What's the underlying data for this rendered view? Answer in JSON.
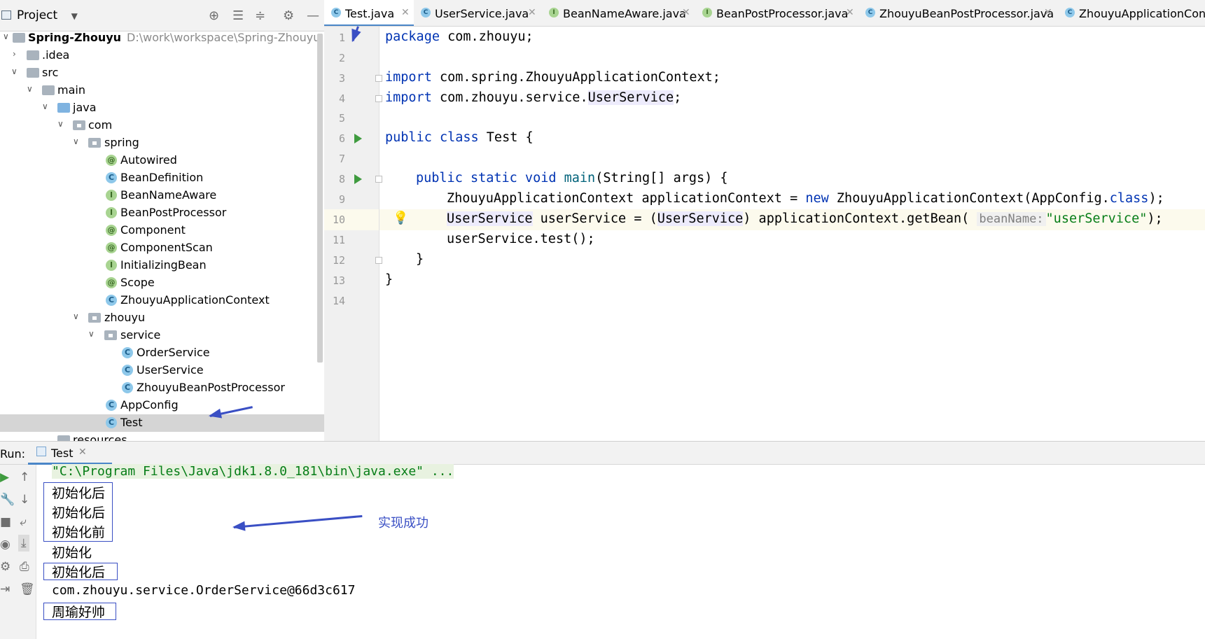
{
  "project_panel": {
    "title": "Project",
    "tree": [
      {
        "label": "Spring-Zhouyu",
        "path": "D:\\work\\workspace\\Spring-Zhouyu"
      },
      {
        "label": ".idea"
      },
      {
        "label": "src"
      },
      {
        "label": "main"
      },
      {
        "label": "java"
      },
      {
        "label": "com"
      },
      {
        "label": "spring"
      },
      {
        "label": "Autowired",
        "kind": "annotation"
      },
      {
        "label": "BeanDefinition",
        "kind": "class"
      },
      {
        "label": "BeanNameAware",
        "kind": "interface"
      },
      {
        "label": "BeanPostProcessor",
        "kind": "interface"
      },
      {
        "label": "Component",
        "kind": "annotation"
      },
      {
        "label": "ComponentScan",
        "kind": "annotation"
      },
      {
        "label": "InitializingBean",
        "kind": "interface"
      },
      {
        "label": "Scope",
        "kind": "annotation"
      },
      {
        "label": "ZhouyuApplicationContext",
        "kind": "class"
      },
      {
        "label": "zhouyu"
      },
      {
        "label": "service"
      },
      {
        "label": "OrderService",
        "kind": "class"
      },
      {
        "label": "UserService",
        "kind": "class"
      },
      {
        "label": "ZhouyuBeanPostProcessor",
        "kind": "class"
      },
      {
        "label": "AppConfig",
        "kind": "class"
      },
      {
        "label": "Test",
        "kind": "class"
      },
      {
        "label": "resources"
      }
    ]
  },
  "editor": {
    "tabs": [
      {
        "label": "Test.java",
        "icon": "C",
        "active": true
      },
      {
        "label": "UserService.java",
        "icon": "C"
      },
      {
        "label": "BeanNameAware.java",
        "icon": "I"
      },
      {
        "label": "BeanPostProcessor.java",
        "icon": "I"
      },
      {
        "label": "ZhouyuBeanPostProcessor.java",
        "icon": "C"
      },
      {
        "label": "ZhouyuApplicationCont",
        "icon": "C"
      }
    ],
    "line_numbers": [
      "1",
      "2",
      "3",
      "4",
      "5",
      "6",
      "7",
      "8",
      "9",
      "10",
      "11",
      "12",
      "13",
      "14"
    ],
    "code": {
      "l1_kw": "package",
      "l1_rest": " com.zhouyu;",
      "l3_kw": "import",
      "l3_rest": " com.spring.ZhouyuApplicationContext;",
      "l4_kw": "import",
      "l4_a": " com.zhouyu.service.",
      "l4_ref": "UserService",
      "l4_end": ";",
      "l6_kw": "public class",
      "l6_rest": " Test {",
      "l8_kw": "public static void",
      "l8_fn": " main",
      "l8_rest": "(String[] args) {",
      "l9_a": "ZhouyuApplicationContext applicationContext = ",
      "l9_kw": "new",
      "l9_b": " ZhouyuApplicationContext(AppConfig.",
      "l9_kw2": "class",
      "l9_c": ");",
      "l10_ref1": "UserService",
      "l10_a": " userService = (",
      "l10_ref2": "UserService",
      "l10_b": ") applicationContext.getBean( ",
      "l10_hint": "beanName:",
      "l10_str": "\"userService\"",
      "l10_c": ");",
      "l11": "userService.test();",
      "l12": "}",
      "l13": "}"
    }
  },
  "run_panel": {
    "label": "Run:",
    "tab_label": "Test",
    "console": [
      "\"C:\\Program Files\\Java\\jdk1.8.0_181\\bin\\java.exe\" ...",
      "初始化后",
      "初始化后",
      "初始化前",
      "初始化",
      "初始化后",
      "com.zhouyu.service.OrderService@66d3c617",
      "周瑜好帅"
    ],
    "annotation": "实现成功"
  },
  "colors": {
    "keyword": "#0033b3",
    "string": "#067d17",
    "annotation_ink": "#3a4fc4",
    "selection": "#d5d5d5"
  }
}
